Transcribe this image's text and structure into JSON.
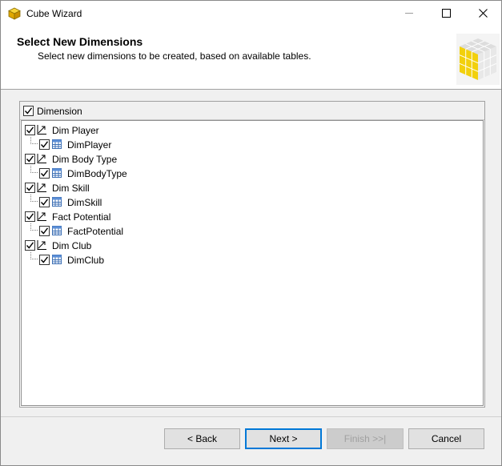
{
  "window": {
    "title": "Cube Wizard",
    "controls": {
      "minimize_icon": "minimize-icon",
      "maximize_icon": "maximize-icon",
      "close_icon": "close-icon"
    }
  },
  "header": {
    "title": "Select New Dimensions",
    "subtitle": "Select new dimensions to be created, based on available tables."
  },
  "list": {
    "column_header": "Dimension",
    "column_checked": true,
    "items": [
      {
        "dimension": "Dim Player",
        "checked": true,
        "table": "DimPlayer",
        "table_checked": true
      },
      {
        "dimension": "Dim Body Type",
        "checked": true,
        "table": "DimBodyType",
        "table_checked": true
      },
      {
        "dimension": "Dim Skill",
        "checked": true,
        "table": "DimSkill",
        "table_checked": true
      },
      {
        "dimension": "Fact Potential",
        "checked": true,
        "table": "FactPotential",
        "table_checked": true
      },
      {
        "dimension": "Dim Club",
        "checked": true,
        "table": "DimClub",
        "table_checked": true
      }
    ]
  },
  "buttons": {
    "back": "< Back",
    "next": "Next >",
    "finish": "Finish >>|",
    "cancel": "Cancel"
  },
  "colors": {
    "accent": "#0078d7",
    "window_bg": "#f0f0f0",
    "cube_yellow": "#f2d00c"
  }
}
